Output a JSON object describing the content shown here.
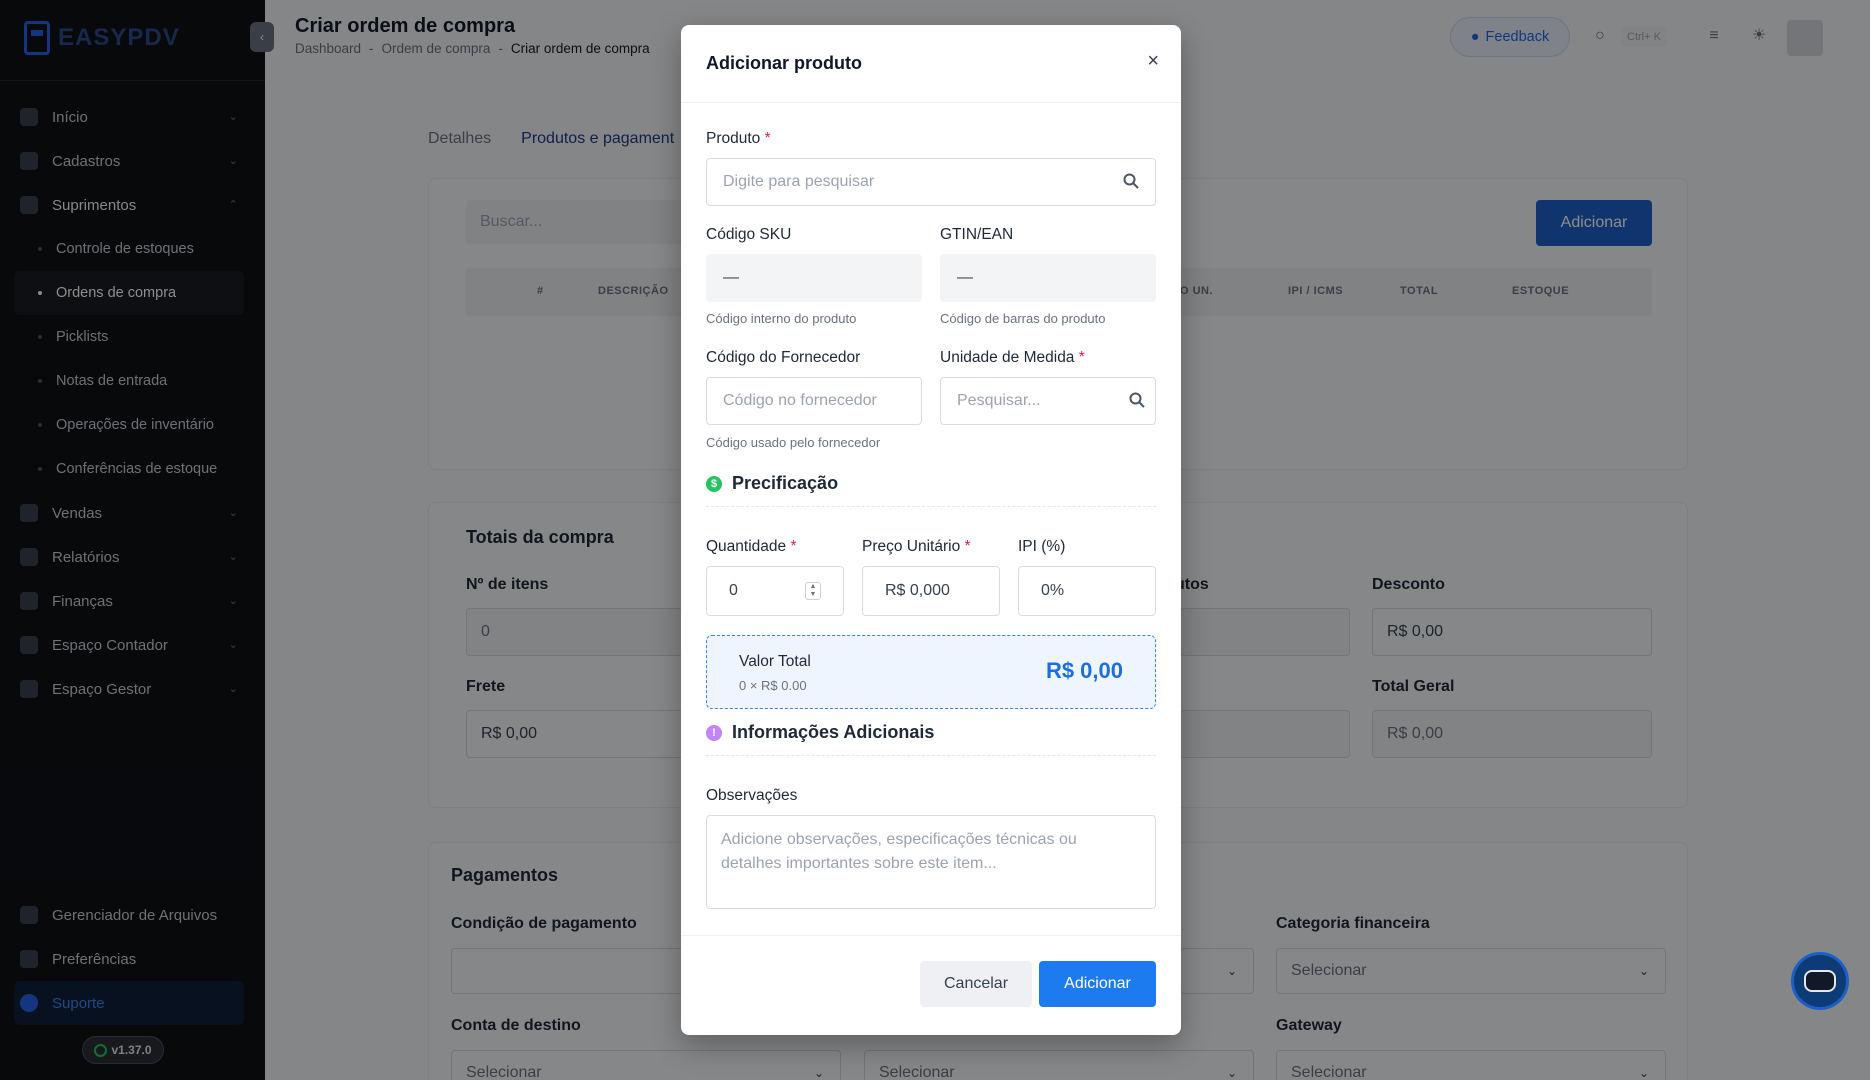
{
  "sidebar": {
    "logo_text": "EASYPDV",
    "nav": [
      {
        "label": "Início"
      },
      {
        "label": "Cadastros"
      },
      {
        "label": "Suprimentos"
      },
      {
        "label": "Vendas"
      },
      {
        "label": "Relatórios"
      },
      {
        "label": "Finanças"
      },
      {
        "label": "Espaço Contador"
      },
      {
        "label": "Espaço Gestor"
      }
    ],
    "sub_items": [
      {
        "label": "Controle de estoques"
      },
      {
        "label": "Ordens de compra"
      },
      {
        "label": "Picklists"
      },
      {
        "label": "Notas de entrada"
      },
      {
        "label": "Operações de inventário"
      },
      {
        "label": "Conferências de estoque"
      }
    ],
    "bottom": [
      {
        "label": "Gerenciador de Arquivos"
      },
      {
        "label": "Preferências"
      },
      {
        "label": "Suporte"
      }
    ],
    "version": "v1.37.0"
  },
  "header": {
    "title": "Criar ordem de compra",
    "breadcrumb": [
      "Dashboard",
      "-",
      "Ordem de compra",
      "-",
      "Criar ordem de compra"
    ],
    "feedback": "Feedback",
    "shortcut": "Ctrl+ K"
  },
  "main": {
    "tabs": [
      "Detalhes",
      "Produtos e pagament"
    ],
    "search_placeholder": "Buscar...",
    "add_button": "Adicionar",
    "columns": [
      "#",
      "DESCRIÇÃO",
      "O UN.",
      "IPI / ICMS",
      "TOTAL",
      "ESTOQUE"
    ],
    "totals": {
      "title": "Totais da compra",
      "items_label": "Nº de itens",
      "items_value": "0",
      "products_label_fragment": "utos",
      "discount_label": "Desconto",
      "discount_value": "R$ 0,00",
      "freight_label": "Frete",
      "freight_value": "R$ 0,00",
      "grand_total_label": "Total Geral",
      "grand_total_value": "R$ 0,00"
    },
    "payments": {
      "title": "Pagamentos",
      "condition_label": "Condição de pagamento",
      "category_label": "Categoria financeira",
      "category_value": "Selecionar",
      "account_label": "Conta de destino",
      "account_value": "Selecionar",
      "middle_value": "Selecionar",
      "gateway_label": "Gateway",
      "gateway_value": "Selecionar"
    }
  },
  "modal": {
    "title": "Adicionar produto",
    "product_label": "Produto",
    "product_placeholder": "Digite para pesquisar",
    "sku_label": "Código SKU",
    "sku_value": "—",
    "sku_help": "Código interno do produto",
    "gtin_label": "GTIN/EAN",
    "gtin_value": "—",
    "gtin_help": "Código de barras do produto",
    "supplier_code_label": "Código do Fornecedor",
    "supplier_code_placeholder": "Código no fornecedor",
    "supplier_code_help": "Código usado pelo fornecedor",
    "unit_label": "Unidade de Medida",
    "unit_placeholder": "Pesquisar...",
    "pricing_title": "Precificação",
    "qty_label": "Quantidade",
    "qty_value": "0",
    "price_label": "Preço Unitário",
    "price_value": "R$ 0,000",
    "ipi_label": "IPI (%)",
    "ipi_value": "0%",
    "total_label": "Valor Total",
    "total_sub": "0 × R$ 0.00",
    "total_value": "R$ 0,00",
    "extra_title": "Informações Adicionais",
    "notes_label": "Observações",
    "notes_placeholder": "Adicione observações, especificações técnicas ou detalhes importantes sobre este item...",
    "cancel": "Cancelar",
    "add": "Adicionar",
    "required_mark": "*"
  },
  "colors": {
    "accent": "#1d7bf0",
    "sidebar_bg": "#0f1115",
    "required": "#e11d48"
  }
}
